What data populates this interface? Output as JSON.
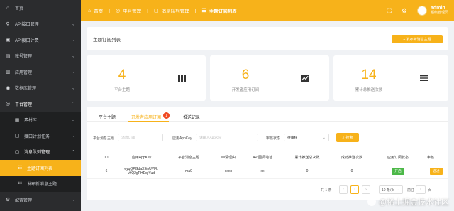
{
  "sidebar": {
    "items": [
      {
        "label": "首页",
        "icon": "home-icon"
      },
      {
        "label": "API接口管理",
        "icon": "api-icon"
      },
      {
        "label": "API接口计费",
        "icon": "billing-icon"
      },
      {
        "label": "账号管理",
        "icon": "account-icon"
      },
      {
        "label": "应用管理",
        "icon": "app-icon"
      },
      {
        "label": "数据库管理",
        "icon": "database-icon"
      },
      {
        "label": "平台管理",
        "icon": "platform-icon"
      },
      {
        "label": "素材库",
        "icon": "material-icon"
      },
      {
        "label": "接口计划任务",
        "icon": "task-icon"
      },
      {
        "label": "消息队列管理",
        "icon": "queue-icon"
      },
      {
        "label": "主题订阅列表",
        "icon": "subscribe-icon"
      },
      {
        "label": "发布新消息主题",
        "icon": "publish-icon"
      },
      {
        "label": "配置管理",
        "icon": "config-icon"
      }
    ]
  },
  "header": {
    "breadcrumb": [
      "首页",
      "平台管理",
      "消息队列管理",
      "主题订阅列表"
    ],
    "username": "admin",
    "role": "超级管理员"
  },
  "page": {
    "title": "主题订阅列表",
    "add_button": "+ 发布新消息主题"
  },
  "stats": [
    {
      "value": "4",
      "label": "平台主题",
      "icon": "grid-icon"
    },
    {
      "value": "6",
      "label": "开发者应用订阅",
      "icon": "trend-icon"
    },
    {
      "value": "14",
      "label": "累计总推送次数",
      "icon": "list-icon"
    }
  ],
  "tabs": [
    {
      "label": "平台主题"
    },
    {
      "label": "开发者应用订阅",
      "badge": "1"
    },
    {
      "label": "推送记录"
    }
  ],
  "filters": {
    "topic_label": "平台消息主题",
    "topic_placeholder": "消息订阅",
    "appkey_label": "应用AppKey",
    "appkey_placeholder": "请输入AppKey",
    "status_label": "审核状态",
    "status_value": "待审核",
    "search_button": "搜索"
  },
  "table": {
    "headers": [
      "ID",
      "应用AppKey",
      "平台消息主题",
      "申请理由",
      "API回调地址",
      "累计推送总次数",
      "成功推送次数",
      "应用订阅状态",
      "审核"
    ],
    "rows": [
      {
        "id": "6",
        "appkey_line1": "eyqQPGdaX9inUVFk",
        "appkey_line2": "vhQ2gPHEqrYud",
        "topic": "ma0",
        "reason": "xxxx",
        "callback": "xx",
        "total": "0",
        "success": "0",
        "status": "开启",
        "audit": "通过"
      }
    ]
  },
  "pagination": {
    "total": "共 1 条",
    "prev": "‹",
    "current": "1",
    "next": "›",
    "page_size": "10 条/页",
    "goto_label": "前往",
    "goto_value": "1",
    "goto_suffix": "页"
  },
  "watermark": {
    "text": "@稀土掘金技术社区"
  },
  "colors": {
    "accent": "#f7b21a",
    "sidebar": "#2b2c2e",
    "success": "#4cb848",
    "badge": "#f04a22"
  }
}
